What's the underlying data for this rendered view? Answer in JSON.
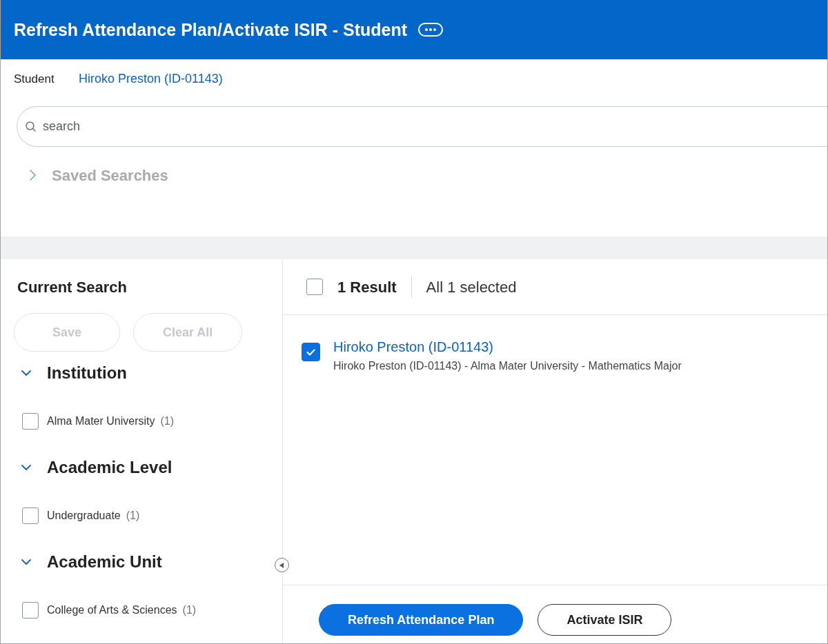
{
  "header": {
    "title": "Refresh Attendance Plan/Activate ISIR - Student"
  },
  "student": {
    "label": "Student",
    "value": "Hiroko Preston (ID-01143)"
  },
  "search": {
    "placeholder": "search"
  },
  "saved_searches": {
    "label": "Saved Searches",
    "expanded": false
  },
  "current_search": {
    "title": "Current Search",
    "buttons": [
      {
        "label": "Save",
        "disabled": true
      },
      {
        "label": "Clear All",
        "disabled": true
      }
    ]
  },
  "facets": [
    {
      "title": "Institution",
      "expanded": true,
      "options": [
        {
          "label": "Alma Mater University",
          "count": "(1)",
          "checked": false
        }
      ]
    },
    {
      "title": "Academic Level",
      "expanded": true,
      "options": [
        {
          "label": "Undergraduate",
          "count": "(1)",
          "checked": false
        }
      ]
    },
    {
      "title": "Academic Unit",
      "expanded": true,
      "options": [
        {
          "label": "College of Arts & Sciences",
          "count": "(1)",
          "checked": false
        }
      ]
    }
  ],
  "results": {
    "select_all": {
      "checked": false
    },
    "count": "1 Result",
    "selection": "All 1 selected",
    "items": [
      {
        "title": "Hiroko Preston (ID-01143)",
        "detail": "Hiroko Preston (ID-01143) - Alma Mater University - Mathematics Major",
        "selected": true
      }
    ]
  },
  "actions": [
    {
      "label": "Refresh Attendance Plan",
      "kind": "primary"
    },
    {
      "label": "Activate ISIR",
      "kind": "secondary"
    }
  ]
}
